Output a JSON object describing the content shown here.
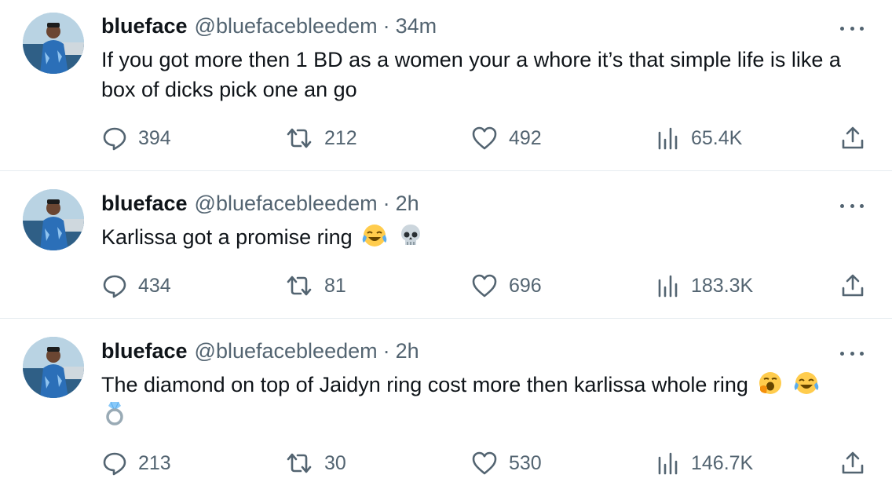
{
  "tweets": [
    {
      "name": "blueface",
      "handle": "@bluefacebleedem",
      "separator": "·",
      "time": "34m",
      "text": "If you got more then 1 BD as a women your a whore it’s that simple life is like a box of dicks pick one an go",
      "emojis": [],
      "replies": "394",
      "reposts": "212",
      "likes": "492",
      "views": "65.4K"
    },
    {
      "name": "blueface",
      "handle": "@bluefacebleedem",
      "separator": "·",
      "time": "2h",
      "text": "Karlissa got a promise ring",
      "emojis": [
        "face-with-tears-of-joy",
        "skull"
      ],
      "replies": "434",
      "reposts": "81",
      "likes": "696",
      "views": "183.3K"
    },
    {
      "name": "blueface",
      "handle": "@bluefacebleedem",
      "separator": "·",
      "time": "2h",
      "text": "The diamond on top of Jaidyn ring cost more then karlissa whole ring",
      "emojis": [
        "yawning-face",
        "face-with-tears-of-joy",
        "ring"
      ],
      "replies": "213",
      "reposts": "30",
      "likes": "530",
      "views": "146.7K"
    }
  ],
  "icons": {
    "reply": "speech-bubble-icon",
    "repost": "repost-arrows-icon",
    "like": "heart-icon",
    "views": "bar-chart-icon",
    "share": "share-upload-icon",
    "more": "more-dots-icon"
  },
  "colors": {
    "text": "#0f1419",
    "secondary": "#536471",
    "divider": "#e6ecf0"
  }
}
